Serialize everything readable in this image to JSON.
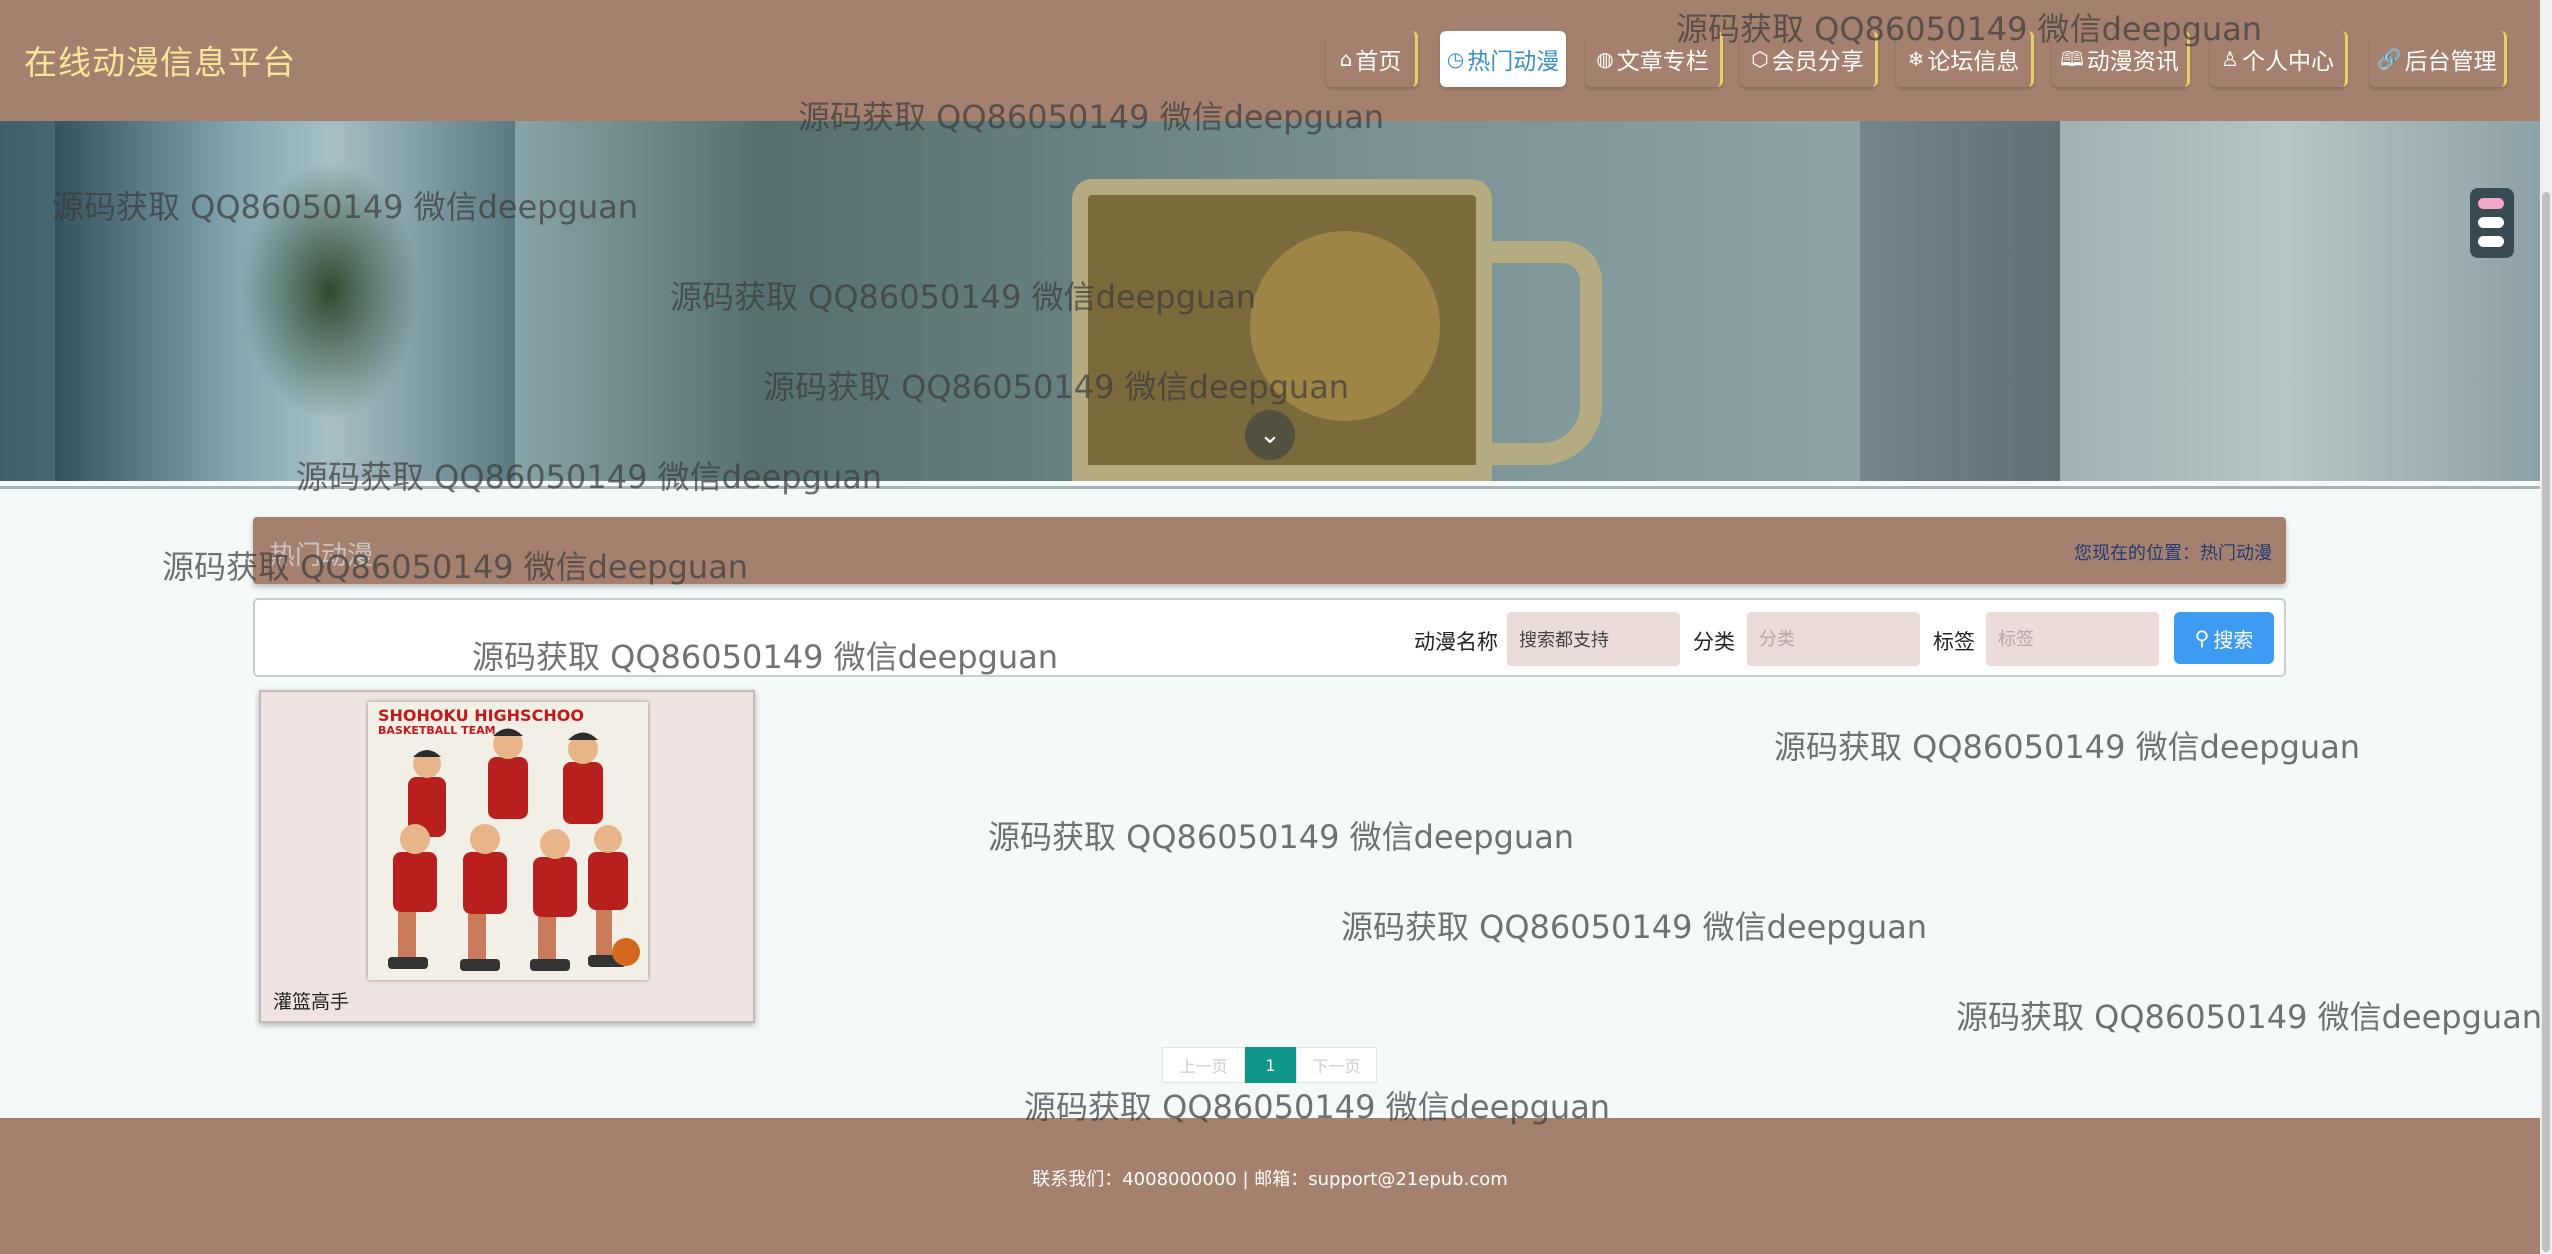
{
  "site": {
    "title": "在线动漫信息平台"
  },
  "nav": [
    {
      "label": "首页",
      "icon": "home-icon",
      "glyph": "⌂"
    },
    {
      "label": "热门动漫",
      "icon": "clock-icon",
      "glyph": "◷"
    },
    {
      "label": "文章专栏",
      "icon": "globe-icon",
      "glyph": "◍"
    },
    {
      "label": "会员分享",
      "icon": "cube-icon",
      "glyph": "⬡"
    },
    {
      "label": "论坛信息",
      "icon": "snowflake-icon",
      "glyph": "❄"
    },
    {
      "label": "动漫资讯",
      "icon": "book-icon",
      "glyph": "🕮"
    },
    {
      "label": "个人中心",
      "icon": "user-icon",
      "glyph": "♙"
    },
    {
      "label": "后台管理",
      "icon": "link-icon",
      "glyph": "🔗"
    }
  ],
  "active_nav": "热门动漫",
  "switcher_colors": [
    "#f2a7c8",
    "#ffffff",
    "#ffffff"
  ],
  "breadcrumb": {
    "title": "热门动漫",
    "location": "您现在的位置：热门动漫"
  },
  "search": {
    "name_label": "动漫名称",
    "name_value": "搜索都支持",
    "category_label": "分类",
    "category_placeholder": "分类",
    "tag_label": "标签",
    "tag_placeholder": "标签",
    "button_label": "搜索"
  },
  "cards": [
    {
      "name": "灌篮高手",
      "poster_title": "SHOHOKU HIGHSCHOO",
      "poster_subtitle": "BASKETBALL TEAM"
    }
  ],
  "pagination": {
    "prev": "上一页",
    "current": "1",
    "next": "下一页"
  },
  "footer": {
    "text": "联系我们：4008000000 | 邮箱：support@21epub.com"
  },
  "watermark": "源码获取 QQ86050149 微信deepguan",
  "colors": {
    "header_bg": "#a6806f",
    "title_color": "#f6e79a",
    "accent_blue": "#3e9bf2",
    "pager_active": "#0f9688"
  }
}
